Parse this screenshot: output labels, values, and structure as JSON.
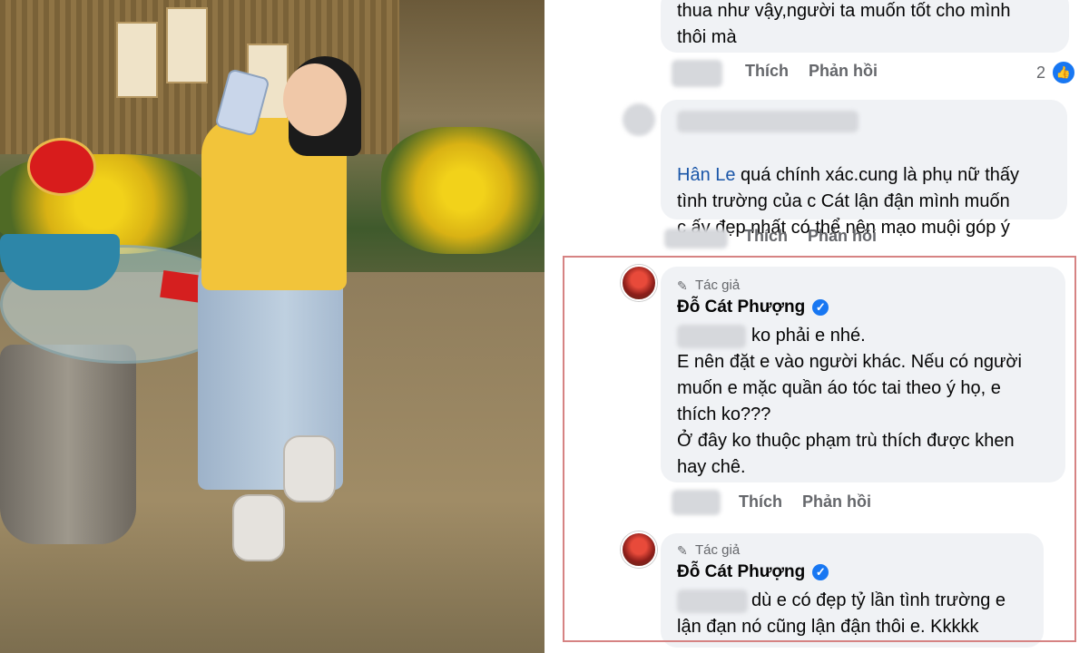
{
  "comments": [
    {
      "text": "thua như vậy,người ta muốn tốt cho mình\nthôi mà",
      "actions": [
        "Thích",
        "Phản hồi"
      ],
      "like_count": "2"
    },
    {
      "mention": "Hân Le",
      "text_after_mention": " quá chính xác.cung là phụ nữ thấy\ntình trường của c Cát lận đận mình muốn\nc ấy đẹp nhất có thể nên mạo muội góp ý",
      "actions": [
        "Thích",
        "Phản hồi"
      ]
    },
    {
      "badge": "Tác giả",
      "author": "Đỗ Cát Phượng",
      "text": "ko phải e nhé.\nE nên đặt e vào người khác. Nếu có người\nmuốn e mặc quần áo tóc tai theo ý họ, e\nthích ko???\nỞ đây ko thuộc phạm trù thích được khen\nhay chê.",
      "actions": [
        "Thích",
        "Phản hồi"
      ]
    },
    {
      "badge": "Tác giả",
      "author": "Đỗ Cát Phượng",
      "text": "dù e có đẹp tỷ lần tình trường e\nlận đạn nó cũng lận đận thôi e. Kkkkk"
    }
  ],
  "icons": {
    "verified": "✓",
    "pencil": "✎",
    "like": "👍"
  },
  "colors": {
    "bubble": "#f0f2f5",
    "action_text": "#65676b",
    "mention": "#1a56a8",
    "highlight_frame": "#d68383",
    "verified": "#1877f2"
  }
}
